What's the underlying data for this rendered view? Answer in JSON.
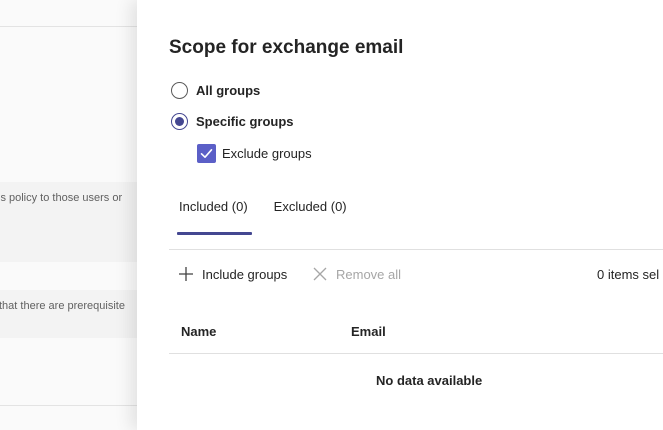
{
  "background": {
    "text_1": "is policy to those users or",
    "text_2": "that there are prerequisite"
  },
  "panel": {
    "title": "Scope for exchange email",
    "radios": [
      {
        "label": "All groups",
        "selected": false
      },
      {
        "label": "Specific groups",
        "selected": true
      }
    ],
    "exclude_checkbox": {
      "label": "Exclude groups",
      "checked": true
    },
    "tabs": [
      {
        "label": "Included (0)",
        "active": true
      },
      {
        "label": "Excluded (0)",
        "active": false
      }
    ],
    "toolbar": {
      "include_label": "Include groups",
      "remove_label": "Remove all",
      "items_selected": "0 items sel"
    },
    "table": {
      "columns": [
        "Name",
        "Email"
      ],
      "empty_text": "No data available"
    }
  },
  "colors": {
    "accent": "#444791",
    "checkbox_fill": "#5b5fc7",
    "disabled_text": "#a6a6a6"
  },
  "icons": [
    "checkmark-icon",
    "plus-icon",
    "close-icon"
  ]
}
